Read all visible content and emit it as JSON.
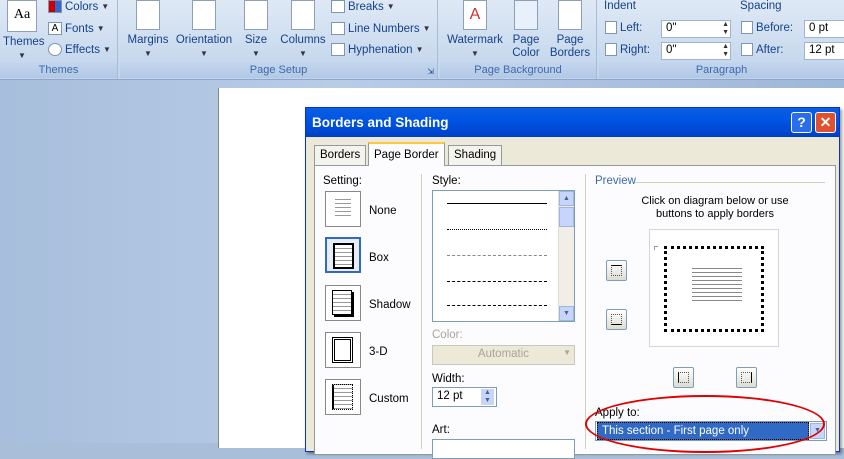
{
  "ribbon": {
    "themes_group": {
      "label": "Themes",
      "themes_btn": "Themes",
      "colors": "Colors",
      "fonts": "Fonts",
      "effects": "Effects"
    },
    "page_setup": {
      "label": "Page Setup",
      "margins": "Margins",
      "orientation": "Orientation",
      "size": "Size",
      "columns": "Columns",
      "breaks": "Breaks",
      "line_numbers": "Line Numbers",
      "hyphenation": "Hyphenation"
    },
    "page_background": {
      "label": "Page Background",
      "watermark": "Watermark",
      "page_color_1": "Page",
      "page_color_2": "Color",
      "page_borders_1": "Page",
      "page_borders_2": "Borders"
    },
    "paragraph": {
      "label": "Paragraph",
      "indent": "Indent",
      "left_label": "Left:",
      "left_value": "0\"",
      "right_label": "Right:",
      "right_value": "0\"",
      "spacing": "Spacing",
      "before_label": "Before:",
      "before_value": "0 pt",
      "after_label": "After:",
      "after_value": "12 pt"
    }
  },
  "dialog": {
    "title": "Borders and Shading",
    "help": "?",
    "close": "✕",
    "tabs": [
      "Borders",
      "Page Border",
      "Shading"
    ],
    "setting_label": "Setting:",
    "settings": [
      "None",
      "Box",
      "Shadow",
      "3-D",
      "Custom"
    ],
    "style_label": "Style:",
    "color_label": "Color:",
    "color_value": "Automatic",
    "width_label": "Width:",
    "width_value": "12 pt",
    "art_label": "Art:",
    "preview_label": "Preview",
    "preview_hint_1": "Click on diagram below or use",
    "preview_hint_2": "buttons to apply borders",
    "apply_label": "Apply to:",
    "apply_value": "This section - First page only"
  },
  "colors": {
    "accent": "#316ac5",
    "title_bar": "#0055e5",
    "highlight_circle": "#e00000"
  }
}
